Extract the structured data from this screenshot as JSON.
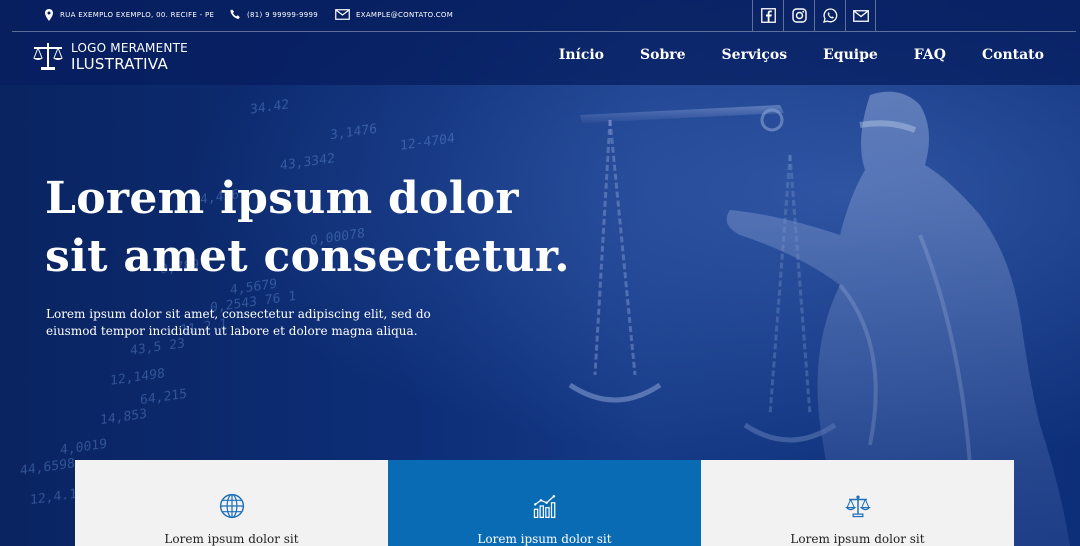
{
  "topbar": {
    "address": "RUA EXEMPLO EXEMPLO, 00. RECIFE - PE",
    "phone": "(81) 9 99999-9999",
    "email": "EXAMPLE@CONTATO.COM",
    "socials": [
      "facebook-icon",
      "instagram-icon",
      "whatsapp-icon",
      "mail-icon"
    ]
  },
  "header": {
    "logo_line1": "LOGO MERAMENTE",
    "logo_line2": "ILUSTRATIVA",
    "nav": [
      "Início",
      "Sobre",
      "Serviços",
      "Equipe",
      "FAQ",
      "Contato"
    ]
  },
  "hero": {
    "headline_line1": "Lorem ipsum dolor",
    "headline_line2": "sit amet consectetur.",
    "subtext": "Lorem ipsum dolor sit amet, consectetur adipiscing elit, sed do eiusmod tempor incididunt ut labore et dolore magna aliqua."
  },
  "cards": [
    {
      "icon": "globe-icon",
      "title": "Lorem ipsum dolor sit"
    },
    {
      "icon": "growth-chart-icon",
      "title": "Lorem ipsum dolor sit"
    },
    {
      "icon": "scales-icon",
      "title": "Lorem ipsum dolor sit"
    }
  ],
  "colors": {
    "primary": "#0b2a6b",
    "accent_card": "#0a6bb5",
    "card_light": "#f2f2f2",
    "icon_blue": "#1f6fb8"
  }
}
